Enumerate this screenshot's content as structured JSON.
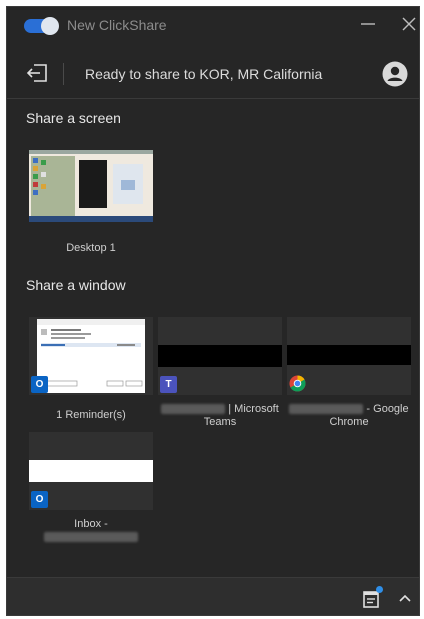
{
  "titlebar": {
    "title": "New ClickShare",
    "toggle_on": true,
    "accent": "#2a6fd6"
  },
  "status": {
    "text": "Ready to share to KOR, MR California"
  },
  "sections": {
    "screen_title": "Share a screen",
    "window_title": "Share a window"
  },
  "screens": [
    {
      "label": "Desktop 1"
    }
  ],
  "windows": [
    {
      "label": "1 Reminder(s)",
      "app_icon": "outlook-icon"
    },
    {
      "label_suffix": "| Microsoft",
      "label_line2": "Teams",
      "app_icon": "teams-icon"
    },
    {
      "label_suffix": "- Google",
      "label_line2": "Chrome",
      "app_icon": "chrome-icon"
    },
    {
      "label": "Inbox -",
      "app_icon": "outlook-icon"
    }
  ],
  "bottombar": {
    "calendar_icon": "calendar-icon",
    "notification_color": "#2f8fe8",
    "expand_icon": "chevron-up-icon"
  }
}
